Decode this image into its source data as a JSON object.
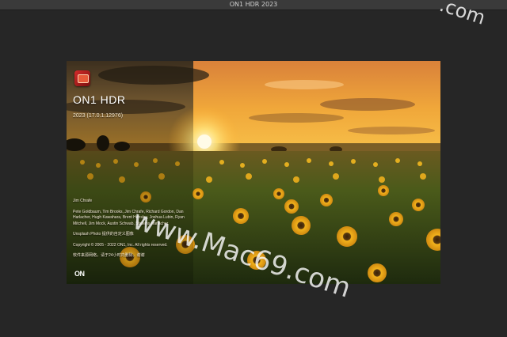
{
  "window": {
    "title": "ON1 HDR 2023"
  },
  "splash": {
    "app_name": "ON1 HDR",
    "version": "2023 (17.0.1.12976)",
    "credits": [
      "Jim Chrafe",
      "Pete Goldbaum, Tim Brooks, Jim Chrafe, Richard Gordon, Dan Harlacher, Hugh Kawahara, Brent Hensley, Joshua Lubin, Ryan Mitchell, Jim Mock, Austin Schwab, Stasens Harlacher",
      "Unsplash Photo 提供的自定义图像",
      "Copyright © 2005 - 2022 ON1, Inc. All rights reserved.",
      "软件来源网络，请于24小时内删除，谢谢"
    ],
    "logo_text": "ON"
  },
  "watermarks": {
    "corner": ".com",
    "main": "www.Mac69.com"
  }
}
